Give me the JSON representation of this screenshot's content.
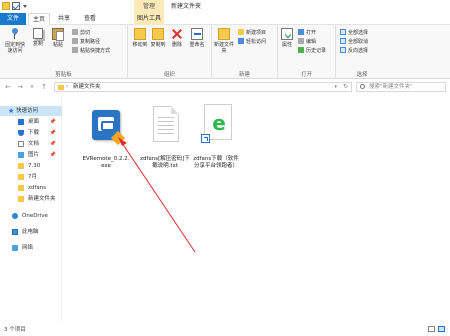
{
  "titlebar": {
    "manage_tab": "管理",
    "window_title": "新建文件夹"
  },
  "tabs": {
    "file": "文件",
    "home": "主页",
    "share": "共享",
    "view": "查看",
    "picture_tools": "图片工具"
  },
  "ribbon": {
    "clipboard": {
      "pin": "固定到快速访问",
      "copy": "复制",
      "paste": "粘贴",
      "cut": "剪切",
      "copy_path": "复制路径",
      "paste_shortcut": "粘贴快捷方式",
      "label": "剪贴板"
    },
    "organize": {
      "move_to": "移动到",
      "copy_to": "复制到",
      "delete": "删除",
      "rename": "重命名",
      "label": "组织"
    },
    "new": {
      "new_folder": "新建文件夹",
      "new_item": "新建项目",
      "easy_access": "轻松访问",
      "label": "新建"
    },
    "open": {
      "properties": "属性",
      "open": "打开",
      "edit": "编辑",
      "history": "历史记录",
      "label": "打开"
    },
    "select": {
      "select_all": "全部选择",
      "select_none": "全部取消",
      "invert": "反向选择",
      "label": "选择"
    }
  },
  "address": {
    "separator": "›",
    "path": "新建文件夹",
    "search_placeholder": "搜索\"新建文件夹\""
  },
  "nav": {
    "items": [
      {
        "label": "快速访问",
        "icon": "star-icon"
      },
      {
        "label": "桌面",
        "icon": "desktop-icon",
        "pinned": true
      },
      {
        "label": "下载",
        "icon": "download-icon",
        "pinned": true
      },
      {
        "label": "文档",
        "icon": "document-icon",
        "pinned": true
      },
      {
        "label": "图片",
        "icon": "picture-icon",
        "pinned": true
      },
      {
        "label": "7.30",
        "icon": "folder-icon"
      },
      {
        "label": "7月",
        "icon": "folder-icon"
      },
      {
        "label": "zdfans",
        "icon": "folder-icon"
      },
      {
        "label": "新建文件夹",
        "icon": "folder-icon"
      },
      {
        "label": "OneDrive",
        "icon": "cloud-icon"
      },
      {
        "label": "此电脑",
        "icon": "computer-icon"
      },
      {
        "label": "网络",
        "icon": "network-icon"
      }
    ],
    "pin_glyph": "📌"
  },
  "files": [
    {
      "name": "EVRemote_0.2.2.exe",
      "icon": "exe-app-icon"
    },
    {
      "name": "zdfans[解压密码]下载说明.txt",
      "icon": "text-file-icon"
    },
    {
      "name": "zdfans下载（软件分享平台领跑者）",
      "icon": "ie-shortcut-icon"
    }
  ],
  "status": {
    "count": "3 个项目"
  },
  "colors": {
    "file_tab": "#1979ca",
    "manage_tab": "#fbe9b7",
    "arrow": "#e03030",
    "selection": "#cce4f7"
  }
}
